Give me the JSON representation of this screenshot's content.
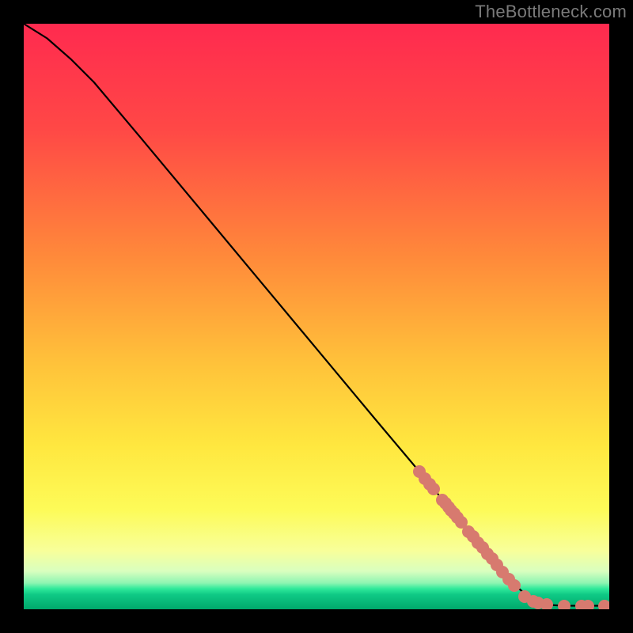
{
  "watermark": "TheBottleneck.com",
  "chart_data": {
    "type": "line",
    "title": "",
    "xlabel": "",
    "ylabel": "",
    "xlim": [
      0,
      100
    ],
    "ylim": [
      0,
      100
    ],
    "gradient_stops": [
      {
        "offset": 0.0,
        "color": "#ff2a4f"
      },
      {
        "offset": 0.18,
        "color": "#ff4846"
      },
      {
        "offset": 0.4,
        "color": "#ff8a3a"
      },
      {
        "offset": 0.58,
        "color": "#ffc23a"
      },
      {
        "offset": 0.72,
        "color": "#ffe73f"
      },
      {
        "offset": 0.83,
        "color": "#fdfb58"
      },
      {
        "offset": 0.9,
        "color": "#f8ff9a"
      },
      {
        "offset": 0.935,
        "color": "#d9ffbf"
      },
      {
        "offset": 0.955,
        "color": "#8ef5b2"
      },
      {
        "offset": 0.965,
        "color": "#2fe99a"
      },
      {
        "offset": 0.975,
        "color": "#0fc985"
      },
      {
        "offset": 1.0,
        "color": "#00a86b"
      }
    ],
    "curve": [
      {
        "x": 0.0,
        "y": 100.0
      },
      {
        "x": 4.0,
        "y": 97.5
      },
      {
        "x": 8.0,
        "y": 94.0
      },
      {
        "x": 12.0,
        "y": 90.0
      },
      {
        "x": 20.0,
        "y": 80.5
      },
      {
        "x": 30.0,
        "y": 68.5
      },
      {
        "x": 40.0,
        "y": 56.5
      },
      {
        "x": 50.0,
        "y": 44.5
      },
      {
        "x": 60.0,
        "y": 32.5
      },
      {
        "x": 68.0,
        "y": 23.0
      },
      {
        "x": 75.0,
        "y": 14.5
      },
      {
        "x": 80.0,
        "y": 8.5
      },
      {
        "x": 84.0,
        "y": 4.0
      },
      {
        "x": 87.0,
        "y": 1.5
      },
      {
        "x": 89.0,
        "y": 0.8
      },
      {
        "x": 92.0,
        "y": 0.6
      },
      {
        "x": 96.0,
        "y": 0.6
      },
      {
        "x": 100.0,
        "y": 0.6
      }
    ],
    "markers": [
      {
        "x": 67.5,
        "y": 23.5
      },
      {
        "x": 68.5,
        "y": 22.3
      },
      {
        "x": 69.3,
        "y": 21.3
      },
      {
        "x": 70.0,
        "y": 20.5
      },
      {
        "x": 71.5,
        "y": 18.7
      },
      {
        "x": 72.0,
        "y": 18.1
      },
      {
        "x": 72.5,
        "y": 17.5
      },
      {
        "x": 73.0,
        "y": 16.9
      },
      {
        "x": 73.5,
        "y": 16.3
      },
      {
        "x": 74.0,
        "y": 15.7
      },
      {
        "x": 74.7,
        "y": 14.9
      },
      {
        "x": 76.0,
        "y": 13.3
      },
      {
        "x": 76.8,
        "y": 12.4
      },
      {
        "x": 77.6,
        "y": 11.4
      },
      {
        "x": 78.4,
        "y": 10.5
      },
      {
        "x": 79.2,
        "y": 9.5
      },
      {
        "x": 80.0,
        "y": 8.6
      },
      {
        "x": 80.8,
        "y": 7.6
      },
      {
        "x": 81.8,
        "y": 6.4
      },
      {
        "x": 82.8,
        "y": 5.2
      },
      {
        "x": 83.8,
        "y": 4.0
      },
      {
        "x": 85.5,
        "y": 2.2
      },
      {
        "x": 87.0,
        "y": 1.3
      },
      {
        "x": 87.8,
        "y": 1.1
      },
      {
        "x": 89.3,
        "y": 0.8
      },
      {
        "x": 92.3,
        "y": 0.6
      },
      {
        "x": 95.3,
        "y": 0.6
      },
      {
        "x": 96.3,
        "y": 0.6
      },
      {
        "x": 99.2,
        "y": 0.6
      }
    ]
  }
}
